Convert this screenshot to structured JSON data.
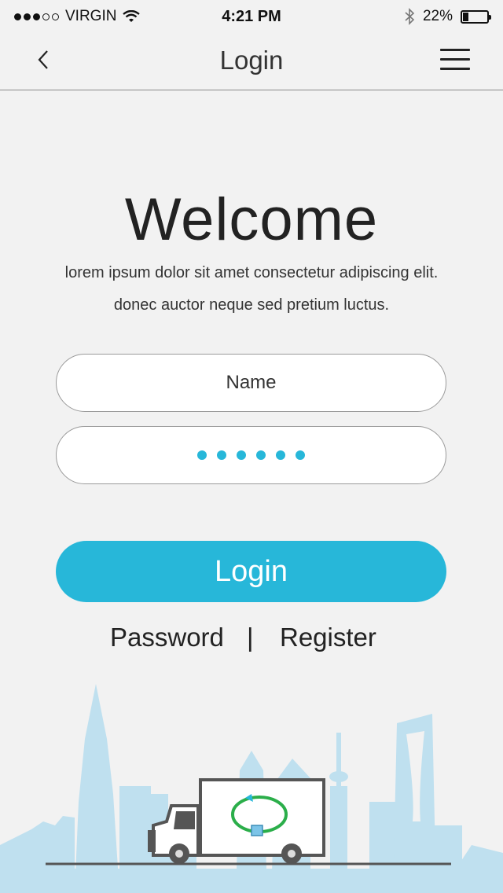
{
  "status_bar": {
    "carrier": "VIRGIN",
    "time": "4:21 PM",
    "battery": "22%",
    "battery_level": 0.22,
    "signal_bars": 3
  },
  "nav": {
    "title": "Login",
    "back_icon": "chevron-left-icon",
    "menu_icon": "hamburger-menu-icon"
  },
  "main": {
    "heading": "Welcome",
    "subtitle_line1": "lorem ipsum dolor sit amet consectetur adipiscing elit.",
    "subtitle_line2": "donec auctor neque sed pretium luctus.",
    "name_placeholder": "Name",
    "password_masked_count": 6,
    "login_button": "Login",
    "password_link": "Password",
    "separator": "|",
    "register_link": "Register"
  },
  "colors": {
    "accent": "#27b7d9",
    "background": "#f2f2f2",
    "skyline": "#bfe0ef"
  }
}
